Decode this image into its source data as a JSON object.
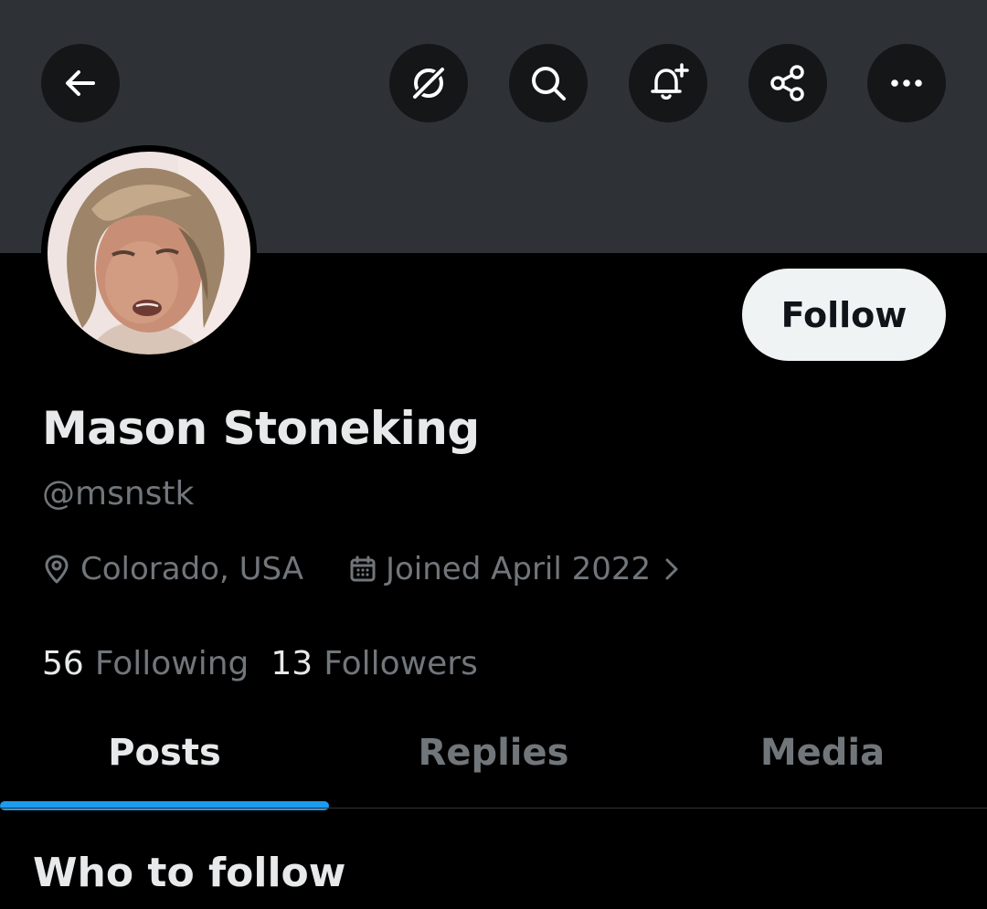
{
  "header": {
    "buttons": [
      {
        "name": "back",
        "icon": "arrow-left-icon"
      },
      {
        "name": "grok",
        "icon": "grok-icon"
      },
      {
        "name": "search",
        "icon": "search-icon"
      },
      {
        "name": "notifications",
        "icon": "bell-plus-icon"
      },
      {
        "name": "share",
        "icon": "share-icon"
      },
      {
        "name": "more",
        "icon": "more-horizontal-icon"
      }
    ]
  },
  "profile": {
    "display_name": "Mason Stoneking",
    "handle": "@msnstk",
    "location": "Colorado, USA",
    "joined": "Joined April 2022",
    "follow_label": "Follow",
    "following_count": "56",
    "following_label": "Following",
    "followers_count": "13",
    "followers_label": "Followers"
  },
  "tabs": [
    {
      "label": "Posts",
      "active": true
    },
    {
      "label": "Replies",
      "active": false
    },
    {
      "label": "Media",
      "active": false
    }
  ],
  "section": {
    "title": "Who to follow"
  },
  "colors": {
    "banner": "#2e3236",
    "background": "#000000",
    "accent": "#1d9bf0",
    "primary_text": "#e7e9ea",
    "secondary_text": "#71767b",
    "follow_button_bg": "#eff3f4"
  }
}
